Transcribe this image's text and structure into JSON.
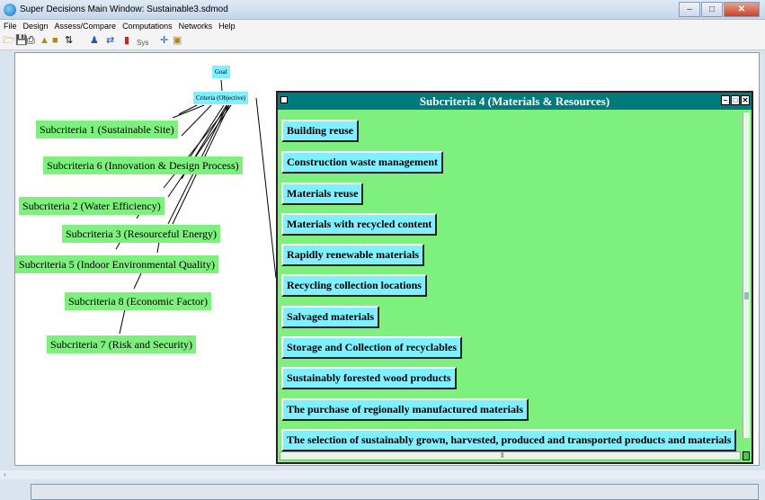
{
  "window": {
    "title": "Super Decisions Main Window: Sustainable3.sdmod"
  },
  "menu": [
    "File",
    "Design",
    "Assess/Compare",
    "Computations",
    "Networks",
    "Help"
  ],
  "toolbar": {
    "sys_label": "Sys"
  },
  "network": {
    "goal": "Goal",
    "criteria": "Criteria (Objective)",
    "subcriteria": [
      "Subcriteria 1 (Sustainable Site)",
      "Subcriteria 6 (Innovation & Design Process)",
      "Subcriteria 2 (Water Efficiency)",
      "Subcriteria 3 (Resourceful Energy)",
      "Subcriteria 5 (Indoor Environmental Quality)",
      "Subcriteria 8 (Economic Factor)",
      "Subcriteria 7 (Risk and Security)"
    ]
  },
  "subwindow": {
    "title": "Subcriteria 4 (Materials & Resources)",
    "items": [
      "Building reuse",
      "Construction waste management",
      "Materials reuse",
      "Materials with recycled content",
      "Rapidly renewable materials",
      "Recycling collection locations",
      "Salvaged materials",
      "Storage and Collection of recyclables",
      "Sustainably forested wood products",
      "The purchase of regionally manufactured materials",
      "The selection of sustainably grown, harvested, produced and transported products and materials"
    ]
  },
  "colors": {
    "node_green": "#7df07d",
    "node_cyan": "#7ff0ff",
    "subwindow_title": "#007a7a"
  }
}
